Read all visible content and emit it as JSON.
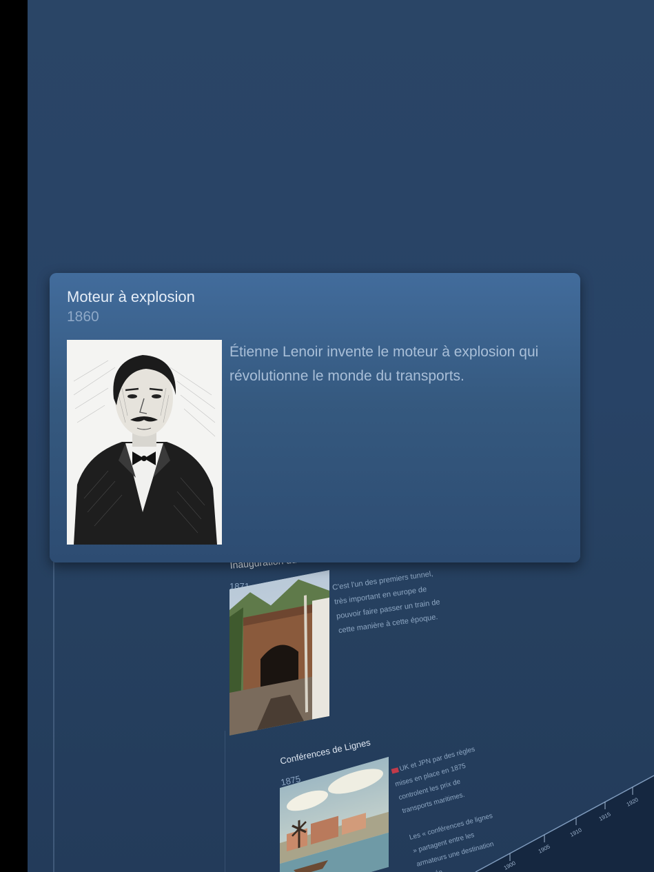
{
  "detail_card": {
    "title": "Moteur à explosion",
    "year": "1860",
    "description": "Étienne Lenoir invente le moteur à explosion qui révolutionne le monde du transports.",
    "image": "portrait-engraving"
  },
  "timeline_events": [
    {
      "title": "Inauguration du tunnel ferroviaire",
      "year": "1871",
      "text": "C'est l'un des premiers tunnel, très important en europe de pouvoir faire passer un train de cette manière à cette époque.",
      "image": "railway-tunnel-photo"
    },
    {
      "title": "Conférences de Lignes",
      "year": "1875",
      "text": "UK et JPN par des règles mises en place en 1875 controlent les prix de transports maritimes.",
      "text2": "Les « conférences de lignes » partagent entre les armateurs une destination donnée.",
      "image": "harbor-postcard"
    }
  ],
  "axis": {
    "ticks": [
      "1900",
      "1905",
      "1910",
      "1915",
      "1920"
    ]
  },
  "colors": {
    "background": "#284366",
    "card_top": "#426c9c",
    "card_bottom": "#2d4c72",
    "title_text": "#e6eef8",
    "muted_text": "#8fa9c8"
  }
}
